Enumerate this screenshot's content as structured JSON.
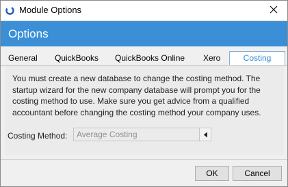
{
  "window": {
    "title": "Module Options"
  },
  "header": {
    "title": "Options"
  },
  "tabs": [
    {
      "label": "General",
      "selected": false
    },
    {
      "label": "QuickBooks",
      "selected": false
    },
    {
      "label": "QuickBooks Online",
      "selected": false
    },
    {
      "label": "Xero",
      "selected": false
    },
    {
      "label": "Costing",
      "selected": true
    }
  ],
  "costing": {
    "message_lines": [
      "You must create a new database to change the costing method.  The",
      "startup wizard for the new company database will prompt you for the",
      "costing method to use.  Make sure you get advice from a qualified",
      "accountant before changing the costing method your company uses."
    ],
    "method_label": "Costing Method:",
    "method_value": "Average Costing"
  },
  "buttons": {
    "ok": "OK",
    "cancel": "Cancel"
  },
  "icons": {
    "app": "app-logo-icon",
    "close": "close-icon",
    "dropdown": "dropdown-arrow-icon"
  },
  "colors": {
    "header_bg": "#3a8fd6",
    "header_text": "#ffffff",
    "selected_tab_text": "#2b8ad8",
    "disabled_text": "#8e8e8e"
  }
}
